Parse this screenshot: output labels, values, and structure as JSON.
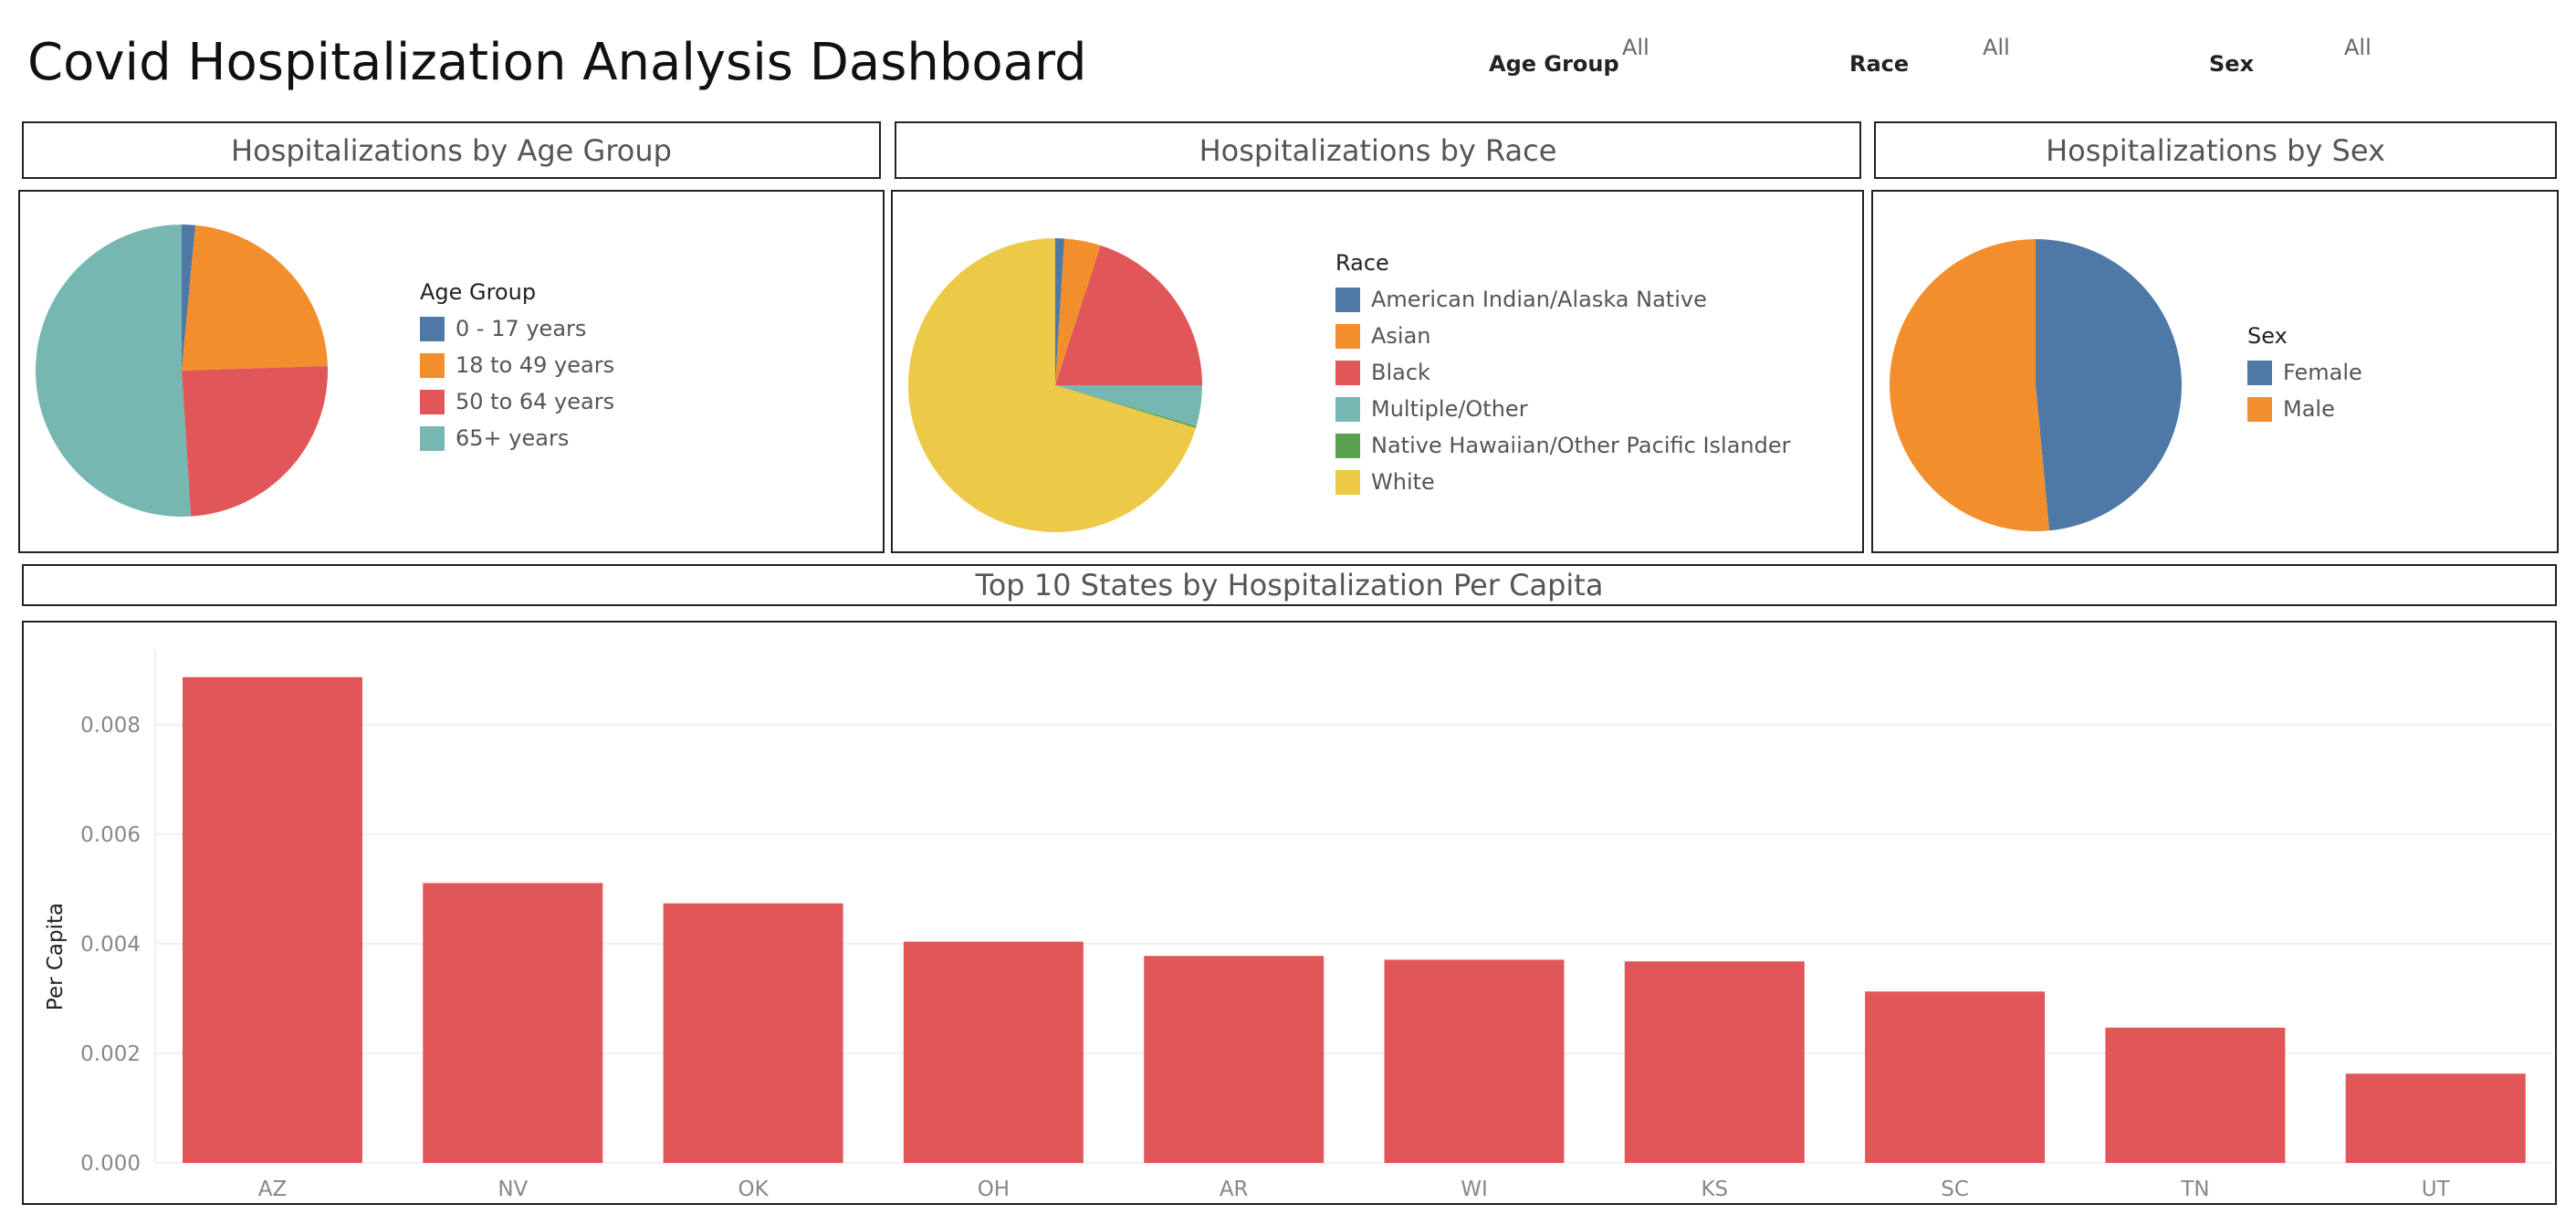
{
  "dashboard": {
    "title": "Covid Hospitalization Analysis Dashboard"
  },
  "filters": [
    {
      "label": "Age Group",
      "value": "All"
    },
    {
      "label": "Race",
      "value": "All"
    },
    {
      "label": "Sex",
      "value": "All"
    }
  ],
  "colors": {
    "blue": "#4e79a7",
    "orange": "#f28e2b",
    "red": "#e15759",
    "teal": "#76b7b2",
    "green": "#59a14f",
    "yellow": "#edc948"
  },
  "chart_data": [
    {
      "type": "pie",
      "title": "Hospitalizations by Age Group",
      "legend_title": "Age Group",
      "legend_position": "right",
      "categories": [
        "0 - 17 years",
        "18 to 49 years",
        "50 to 64 years",
        "65+ years"
      ],
      "values": [
        1.5,
        23.0,
        24.5,
        51.0
      ],
      "colors": [
        "#4e79a7",
        "#f28e2b",
        "#e15759",
        "#76b7b2"
      ]
    },
    {
      "type": "pie",
      "title": "Hospitalizations by Race",
      "legend_title": "Race",
      "legend_position": "right",
      "categories": [
        "American Indian/Alaska Native",
        "Asian",
        "Black",
        "Multiple/Other",
        "Native Hawaiian/Other Pacific Islander",
        "White"
      ],
      "values": [
        1.0,
        4.0,
        20.0,
        4.5,
        0.2,
        70.3
      ],
      "colors": [
        "#4e79a7",
        "#f28e2b",
        "#e15759",
        "#76b7b2",
        "#59a14f",
        "#edc948"
      ]
    },
    {
      "type": "pie",
      "title": "Hospitalizations by Sex",
      "legend_title": "Sex",
      "legend_position": "right",
      "categories": [
        "Female",
        "Male"
      ],
      "values": [
        48.5,
        51.5
      ],
      "colors": [
        "#4e79a7",
        "#f28e2b"
      ]
    },
    {
      "type": "bar",
      "title": "Top 10 States by Hospitalization Per Capita",
      "xlabel": "",
      "ylabel": "Per Capita",
      "categories": [
        "AZ",
        "NV",
        "OK",
        "OH",
        "AR",
        "WI",
        "KS",
        "SC",
        "TN",
        "UT"
      ],
      "values": [
        0.00887,
        0.00511,
        0.00474,
        0.00404,
        0.00378,
        0.00371,
        0.00368,
        0.00313,
        0.00247,
        0.00163
      ],
      "ylim": [
        0,
        0.0092
      ],
      "yticks": [
        "0.000",
        "0.002",
        "0.004",
        "0.006",
        "0.008"
      ],
      "ytick_values": [
        0,
        0.002,
        0.004,
        0.006,
        0.008
      ],
      "grid": true,
      "color": "#e15759"
    }
  ]
}
